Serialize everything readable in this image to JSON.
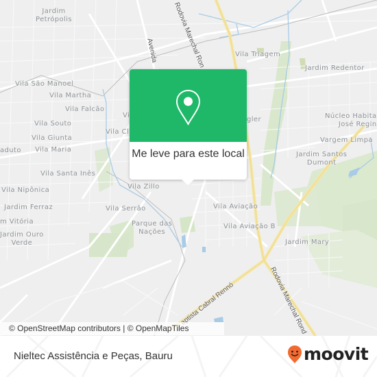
{
  "map": {
    "labels": {
      "jardim_petropolis": "Jardim\nPetrópolis",
      "vila_sao_manoel": "Vila São Manoel",
      "vila_martha": "Vila Martha",
      "vila_falcao": "Vila Falcão",
      "vila_souto": "Vila Souto",
      "vila_giunta": "Vila Giunta",
      "viaduto": "aduto",
      "vila_maria": "Vila Maria",
      "vila_santa_ines": "Vila Santa Inês",
      "vila_niponica": "Vila Nipônica",
      "jardim_ferraz": "Jardim Ferraz",
      "jardim_vitoria": "m Vitória",
      "jardim_ouro_verde": "Jardim Ouro\nVerde",
      "vila_serrao": "Vila Serrão",
      "parque_das_nacoes": "Parque das\nNações",
      "vila_zillo": "Vila Zillo",
      "vila_cl": "Vila Cl",
      "vila_v": "Vi",
      "vila_aviacao": "Vila Aviação",
      "vila_aviacao_b": "Vila Aviação B",
      "jardim_mary": "Jardim Mary",
      "vila_triagem": "Vila Triagem",
      "jardim_redentor": "Jardim Redentor",
      "nucleo_habitacional": "Núcleo Habita\nJosé Regin",
      "vargem_limpa": "Vargem Limpa",
      "jardim_santos_dumont": "Jardim Santos\nDumont",
      "gler": "gler"
    },
    "roads": {
      "rodovia_marechal_top": "Rodovia Marechal Ron",
      "avenida": "Avenida",
      "rodovia_marechal_bottom": "Rodovia Marechal Rond",
      "cabral_renno": "aptista Cabral Rennó"
    },
    "attribution": "© OpenStreetMap contributors | © OpenMapTiles",
    "colors": {
      "background": "#efefef",
      "park": "#d5e6c8",
      "water": "#a8d1ec",
      "highway": "#f8e7a0",
      "popup_green": "#1eb868"
    }
  },
  "popup": {
    "icon": "map-pin-icon",
    "label": "Me leve para este local"
  },
  "footer": {
    "title": "Nieltec Assistência e Peças, Bauru",
    "brand": "moovit",
    "brand_color": "#f26a30"
  }
}
